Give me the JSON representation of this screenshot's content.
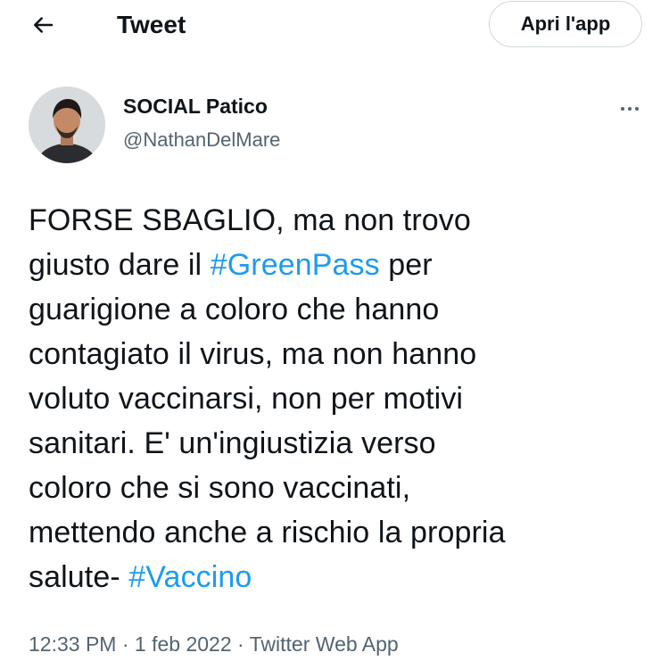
{
  "header": {
    "title": "Tweet",
    "open_app_label": "Apri l'app",
    "back_icon": "arrow-left-icon",
    "more_icon": "more-horizontal-icon"
  },
  "author": {
    "display_name": "SOCIAL Patico",
    "handle": "@NathanDelMare"
  },
  "tweet": {
    "lines": [
      [
        "FORSE SBAGLIO, ma non trovo"
      ],
      [
        "giusto dare il ",
        "#GreenPass",
        " per"
      ],
      [
        "guarigione a coloro che hanno"
      ],
      [
        "contagiato il virus, ma non hanno"
      ],
      [
        "voluto vaccinarsi, non per motivi"
      ],
      [
        "sanitari. E' un'ingiustizia verso"
      ],
      [
        "coloro che si sono vaccinati,"
      ],
      [
        "mettendo anche a rischio la propria"
      ],
      [
        "salute- ",
        "#Vaccino"
      ]
    ],
    "hashtags": [
      "#GreenPass",
      "#Vaccino"
    ]
  },
  "meta": {
    "time": "12:33 PM",
    "separator1": " · ",
    "date": "1 feb 2022",
    "separator2": " · ",
    "source": "Twitter Web App"
  },
  "colors": {
    "text": "#0f1419",
    "secondary": "#536471",
    "hashtag": "#1d9bf0",
    "border": "#cfd9de"
  }
}
